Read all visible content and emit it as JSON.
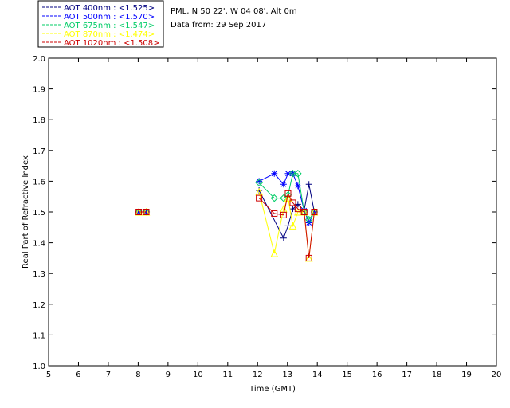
{
  "info": {
    "station": "PML, N 50 22', W 04 08', Alt 0m",
    "date": "Data from: 29 Sep 2017"
  },
  "chart_data": {
    "type": "scatter",
    "xlabel": "Time (GMT)",
    "ylabel": "Real Part of Refractive Index",
    "xlim": [
      5,
      20
    ],
    "ylim": [
      1.0,
      2.0
    ],
    "x_ticks": [
      "5",
      "6",
      "7",
      "8",
      "9",
      "10",
      "11",
      "12",
      "13",
      "14",
      "15",
      "16",
      "17",
      "18",
      "19",
      "20"
    ],
    "y_ticks": [
      "1.0",
      "1.1",
      "1.2",
      "1.3",
      "1.4",
      "1.5",
      "1.6",
      "1.7",
      "1.8",
      "1.9",
      "2.0"
    ],
    "legend_position": "top-left",
    "series": [
      {
        "name": "AOT  400nm : <1.525>",
        "color": "#000080",
        "marker": "plus",
        "points": [
          [
            8.02,
            1.5
          ],
          [
            8.27,
            1.5
          ],
          [
            12.05,
            1.57
          ],
          [
            12.87,
            1.415
          ],
          [
            13.02,
            1.455
          ],
          [
            13.18,
            1.51
          ],
          [
            13.35,
            1.525
          ],
          [
            13.56,
            1.505
          ],
          [
            13.72,
            1.59
          ],
          [
            13.9,
            1.5
          ]
        ]
      },
      {
        "name": "AOT  500nm : <1.570>",
        "color": "#0000ff",
        "marker": "asterisk",
        "points": [
          [
            8.02,
            1.5
          ],
          [
            8.27,
            1.5
          ],
          [
            12.05,
            1.6
          ],
          [
            12.56,
            1.625
          ],
          [
            12.87,
            1.59
          ],
          [
            13.02,
            1.625
          ],
          [
            13.18,
            1.625
          ],
          [
            13.35,
            1.585
          ],
          [
            13.56,
            1.505
          ],
          [
            13.72,
            1.465
          ],
          [
            13.9,
            1.5
          ]
        ]
      },
      {
        "name": "AOT  675nm : <1.547>",
        "color": "#00cc66",
        "marker": "diamond",
        "points": [
          [
            8.02,
            1.5
          ],
          [
            8.27,
            1.5
          ],
          [
            12.05,
            1.595
          ],
          [
            12.56,
            1.545
          ],
          [
            12.87,
            1.545
          ],
          [
            13.02,
            1.555
          ],
          [
            13.18,
            1.625
          ],
          [
            13.35,
            1.625
          ],
          [
            13.56,
            1.5
          ],
          [
            13.72,
            1.475
          ],
          [
            13.9,
            1.5
          ]
        ]
      },
      {
        "name": "AOT  870nm : <1.474>",
        "color": "#ffff00",
        "marker": "triangle",
        "points": [
          [
            8.02,
            1.5
          ],
          [
            8.27,
            1.5
          ],
          [
            12.05,
            1.565
          ],
          [
            12.56,
            1.365
          ],
          [
            12.87,
            1.51
          ],
          [
            13.02,
            1.545
          ],
          [
            13.18,
            1.455
          ],
          [
            13.35,
            1.5
          ],
          [
            13.56,
            1.5
          ],
          [
            13.72,
            1.35
          ],
          [
            13.9,
            1.5
          ]
        ]
      },
      {
        "name": "AOT 1020nm : <1.508>",
        "color": "#cc0000",
        "marker": "square",
        "points": [
          [
            8.02,
            1.5
          ],
          [
            8.27,
            1.5
          ],
          [
            12.05,
            1.545
          ],
          [
            12.56,
            1.495
          ],
          [
            12.87,
            1.49
          ],
          [
            13.02,
            1.56
          ],
          [
            13.18,
            1.53
          ],
          [
            13.35,
            1.51
          ],
          [
            13.56,
            1.5
          ],
          [
            13.72,
            1.35
          ],
          [
            13.9,
            1.5
          ]
        ]
      }
    ]
  }
}
